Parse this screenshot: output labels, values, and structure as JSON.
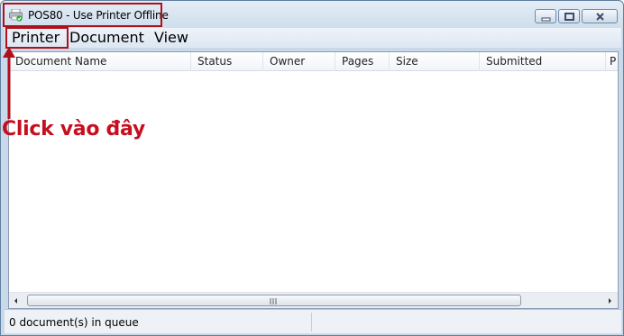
{
  "window": {
    "title": "POS80  -  Use Printer Offline"
  },
  "menu": {
    "items": [
      "Printer",
      "Document",
      "View"
    ]
  },
  "table": {
    "columns": [
      "Document Name",
      "Status",
      "Owner",
      "Pages",
      "Size",
      "Submitted",
      "P"
    ],
    "rows": []
  },
  "status": {
    "text": "0 document(s) in queue"
  },
  "annotation": {
    "text": "Click vào đây",
    "color": "#c50f1f"
  },
  "icons": {
    "title_icon": "printer-check-icon",
    "scroll_left": "arrow-left-icon",
    "scroll_right": "arrow-right-icon"
  }
}
